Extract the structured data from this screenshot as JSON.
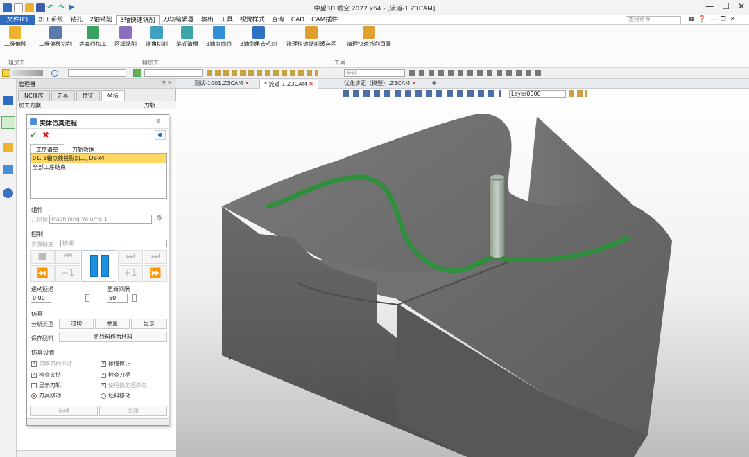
{
  "titlebar": {
    "title": "中望3D 瞻空 2027 x64 - [流道-1.Z3CAM]"
  },
  "menu": {
    "items": [
      "文件(F)",
      "加工系统",
      "钻孔",
      "2轴铣削",
      "3轴快速铣削",
      "刀轨编辑器",
      "输出",
      "工具",
      "视觉样式",
      "查询",
      "CAD",
      "CAM插件"
    ],
    "search_placeholder": "查找命令"
  },
  "ribbon": {
    "buttons": [
      "二维偏移",
      "二维偏移切削",
      "等高线加工",
      "区域铣削",
      "清角切削",
      "笔式清根",
      "3轴点曲线",
      "3轴倒角去毛刺",
      "清理快速铣削缓存区",
      "清理快速铣削目录"
    ],
    "groups": [
      "粗加工",
      "精加工",
      "工具"
    ]
  },
  "toolbar": {
    "filter_combo": "全部"
  },
  "manager": {
    "title": "管理器",
    "tabs": [
      "NC排序",
      "刀具",
      "特征",
      "坐标"
    ],
    "col1": "加工方案",
    "col2": "刀轨"
  },
  "dialog": {
    "title": "实体仿真进程",
    "tabs": [
      "工序清单",
      "刀轨数据"
    ],
    "ops": [
      "01. 3轴点线投影加工, DBR4",
      "全部工序结束"
    ],
    "sec_component": "组件",
    "component_label": "几何体",
    "component_value": "Machining Volume 1",
    "sec_control": "控制",
    "step_label": "步骤精度",
    "step_value": "精细",
    "minus1": "−1",
    "plus1": "+1",
    "delay_label": "运动延迟",
    "delay_value": "0.00",
    "interval_label": "更新间隔",
    "interval_value": "50",
    "sec_sim": "仿真",
    "analysis_label": "分析类型",
    "analysis_buttons": [
      "过切",
      "余量",
      "显示"
    ],
    "save_label": "保存残料",
    "save_button": "将残料作为坯料",
    "sec_settings": "仿真设置",
    "checks": [
      {
        "label": "忽略刀柄干涉",
        "on": true,
        "dim": true
      },
      {
        "label": "碰撞停止",
        "on": true,
        "dim": false
      },
      {
        "label": "检查夹持",
        "on": true,
        "dim": false
      },
      {
        "label": "检查刀柄",
        "on": true,
        "dim": false
      },
      {
        "label": "显示刀轨",
        "on": false,
        "dim": false
      },
      {
        "label": "使用指定坯颜色",
        "on": true,
        "dim": true
      }
    ],
    "radio1": "刀具移动",
    "radio2": "坯料移动",
    "options_button": "选项",
    "close_button": "关闭"
  },
  "doc_tabs": [
    "测试-1001.Z3CAM",
    "* 流道-1.Z3CAM",
    "优化步距（模塑）.Z3CAM"
  ],
  "view_toolbar": {
    "layer": "Layer0000"
  },
  "colors": {
    "accent": "#2f6cc0",
    "solid": "#6b6b6b",
    "toolpath": "#2e8b3a",
    "tab_active": "#ffd863"
  }
}
